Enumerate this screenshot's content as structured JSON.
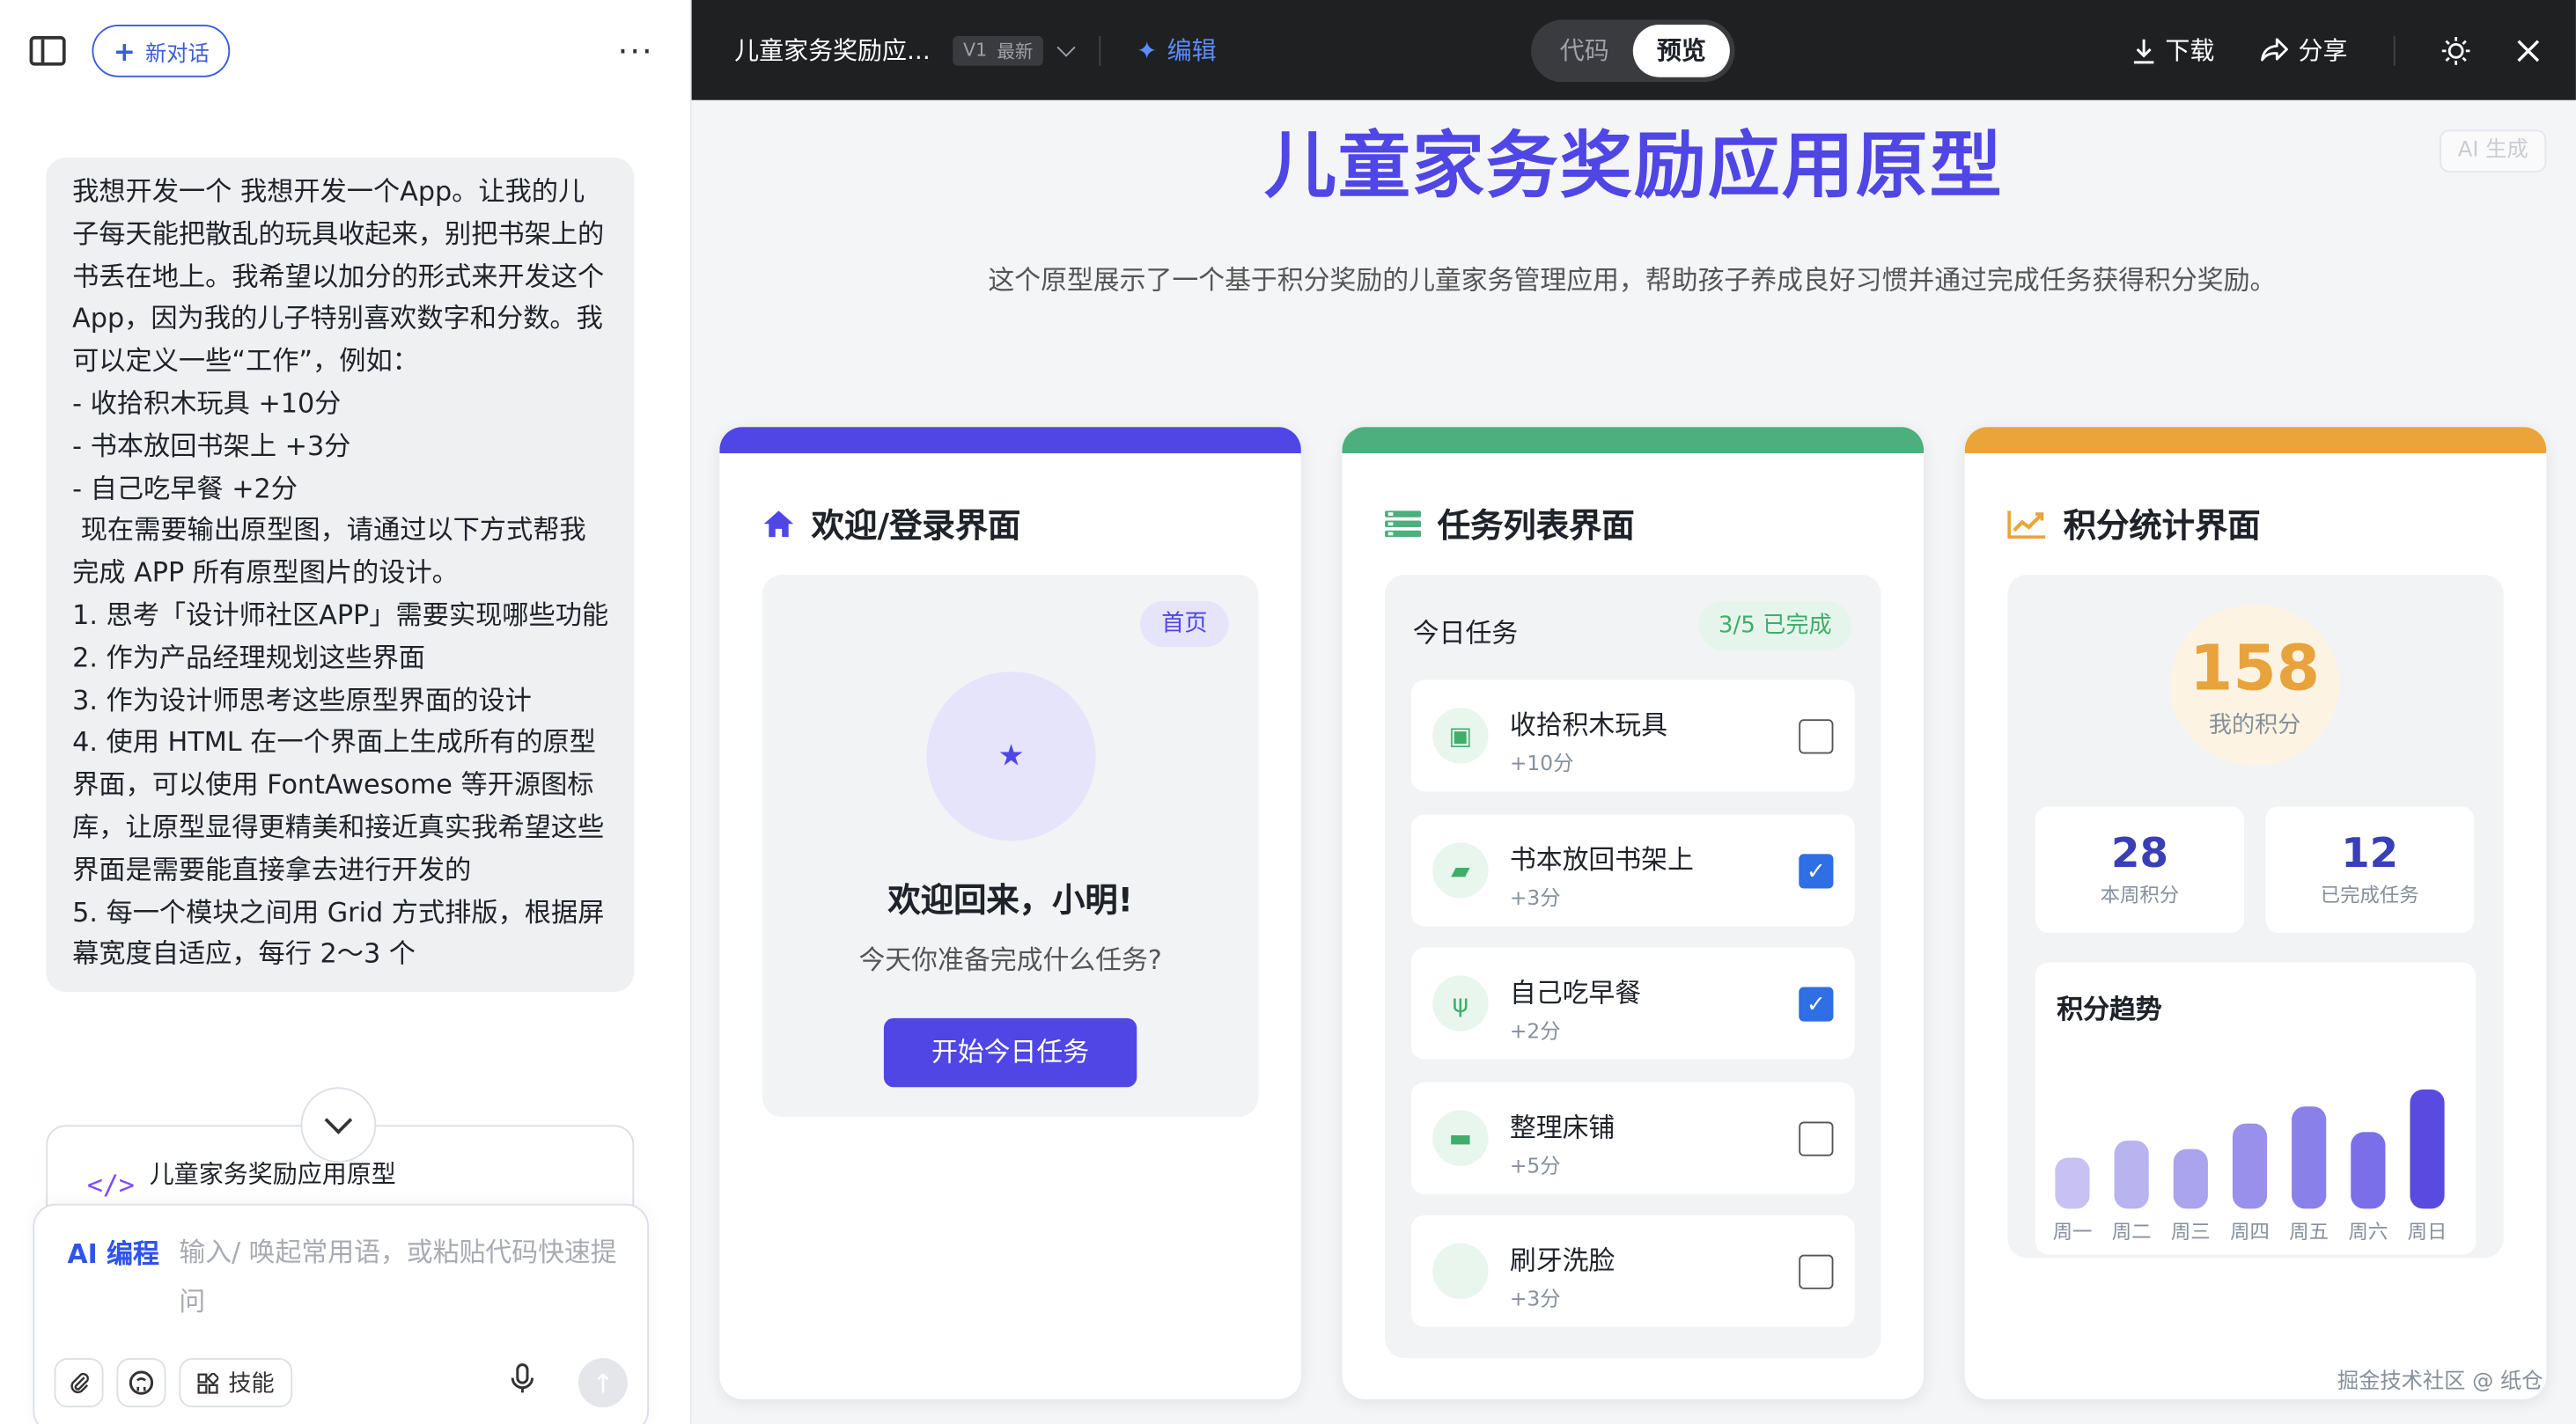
{
  "sidebar": {
    "new_chat_label": "新对话",
    "more_label": "···",
    "message": "我想开发一个 我想开发一个App。让我的儿子每天能把散乱的玩具收起来，别把书架上的书丢在地上。我希望以加分的形式来开发这个App，因为我的儿子特别喜欢数字和分数。我可以定义一些“工作”，例如：\n- 收拾积木玩具 +10分\n- 书本放回书架上 +3分\n- 自己吃早餐 +2分\n 现在需要输出原型图，请通过以下方式帮我完成 APP 所有原型图片的设计。\n1. 思考「设计师社区APP」需要实现哪些功能\n2. 作为产品经理规划这些界面\n3. 作为设计师思考这些原型界面的设计\n4. 使用 HTML 在一个界面上生成所有的原型界面，可以使用 FontAwesome 等开源图标库，让原型显得更精美和接近真实我希望这些界面是需要能直接拿去进行开发的\n5. 每一个模块之间用 Grid 方式排版，根据屏幕宽度自适应，每行 2～3 个",
    "artifact_title": "儿童家务奖励应用原型",
    "artifact_icon": "</>",
    "input": {
      "ai_label": "AI 编程",
      "placeholder": "输入/ 唤起常用语，或粘贴代码快速提问",
      "skill_label": "技能"
    }
  },
  "topbar": {
    "doc_title": "儿童家务奖励应...",
    "version": "V1",
    "latest": "最新",
    "edit_label": "编辑",
    "tab_code": "代码",
    "tab_preview": "预览",
    "download_label": "下载",
    "share_label": "分享"
  },
  "preview": {
    "ai_tag": "AI 生成",
    "title": "儿童家务奖励应用原型",
    "subtitle": "这个原型展示了一个基于积分奖励的儿童家务管理应用，帮助孩子养成良好习惯并通过完成任务获得积分奖励。",
    "cards": {
      "welcome": {
        "title": "欢迎/登录界面",
        "accent": "#4f46e5",
        "badge": "首页",
        "greeting": "欢迎回来，小明!",
        "question": "今天你准备完成什么任务?",
        "button": "开始今日任务"
      },
      "tasks": {
        "title": "任务列表界面",
        "accent": "#4caf7d",
        "header": "今日任务",
        "progress": "3/5 已完成",
        "items": [
          {
            "name": "收拾积木玩具",
            "points": "+10分",
            "icon": "cubes-icon",
            "done": false
          },
          {
            "name": "书本放回书架上",
            "points": "+3分",
            "icon": "book-icon",
            "done": true
          },
          {
            "name": "自己吃早餐",
            "points": "+2分",
            "icon": "utensils-icon",
            "done": true
          },
          {
            "name": "整理床铺",
            "points": "+5分",
            "icon": "bed-icon",
            "done": false
          },
          {
            "name": "刷牙洗脸",
            "points": "+3分",
            "icon": "tooth-icon",
            "done": false
          }
        ]
      },
      "stats": {
        "title": "积分统计界面",
        "accent": "#eaa43a",
        "total": "158",
        "total_label": "我的积分",
        "week_points": "28",
        "week_points_label": "本周积分",
        "done_tasks": "12",
        "done_tasks_label": "已完成任务",
        "trend_title": "积分趋势"
      }
    },
    "footer": "掘金技术社区 @ 纸仓"
  },
  "chart_data": {
    "type": "bar",
    "title": "积分趋势",
    "categories": [
      "周一",
      "周二",
      "周三",
      "周四",
      "周五",
      "周六",
      "周日"
    ],
    "values": [
      30,
      40,
      35,
      50,
      60,
      45,
      70
    ],
    "colors": [
      "#c7c2f3",
      "#b9b3f0",
      "#aaa3ee",
      "#9990ec",
      "#8a80ea",
      "#7a6fe8",
      "#5a4be0"
    ]
  }
}
